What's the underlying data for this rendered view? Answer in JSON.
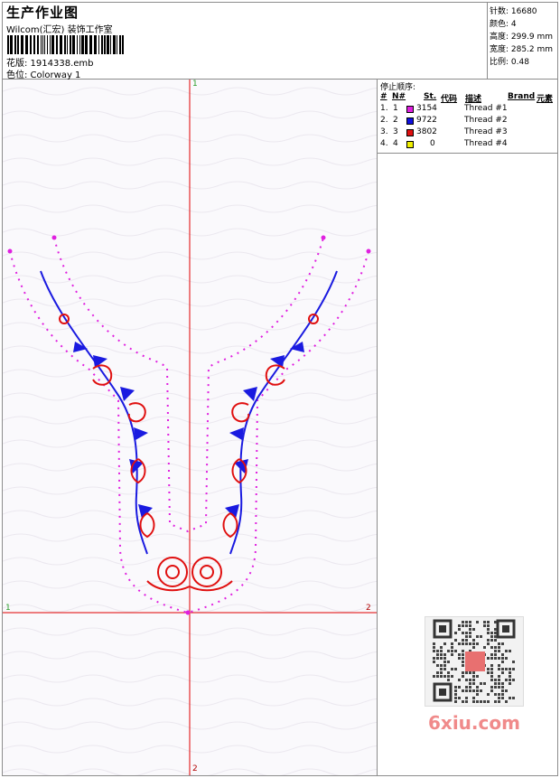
{
  "header": {
    "title": "生产作业图",
    "company": "Wilcom(汇宏) 装饰工作室",
    "design_label": "花版: 1914338.emb",
    "colorway_label": "色位: Colorway 1"
  },
  "stats": {
    "stitches": "针数: 16680",
    "colors": "颜色: 4",
    "height": "高度: 299.9 mm",
    "width": "宽度: 285.2 mm",
    "scale": "比例: 0.48"
  },
  "stop_sequence": {
    "title": "停止顺序:",
    "headers": {
      "num": "#",
      "n": "N#",
      "st": "St.",
      "code": "代码",
      "desc": "描述",
      "brand": "Brand",
      "element": "元素"
    },
    "rows": [
      {
        "num": "1.",
        "n": "1",
        "color": "#e020e0",
        "st": "3154",
        "desc": "Thread #1"
      },
      {
        "num": "2.",
        "n": "2",
        "color": "#1010e0",
        "st": "9722",
        "desc": "Thread #2"
      },
      {
        "num": "3.",
        "n": "3",
        "color": "#e01010",
        "st": "3802",
        "desc": "Thread #3"
      },
      {
        "num": "4.",
        "n": "4",
        "color": "#f0f000",
        "st": "0",
        "desc": "Thread #4"
      }
    ]
  },
  "axes": {
    "top": "1",
    "left": "1",
    "right": "2",
    "bottom": "2"
  },
  "watermark": "6xiu.com",
  "colors": {
    "crosshair": "#e00000",
    "magenta": "#e020e0",
    "blue": "#1a1ae0",
    "red": "#e01010"
  }
}
